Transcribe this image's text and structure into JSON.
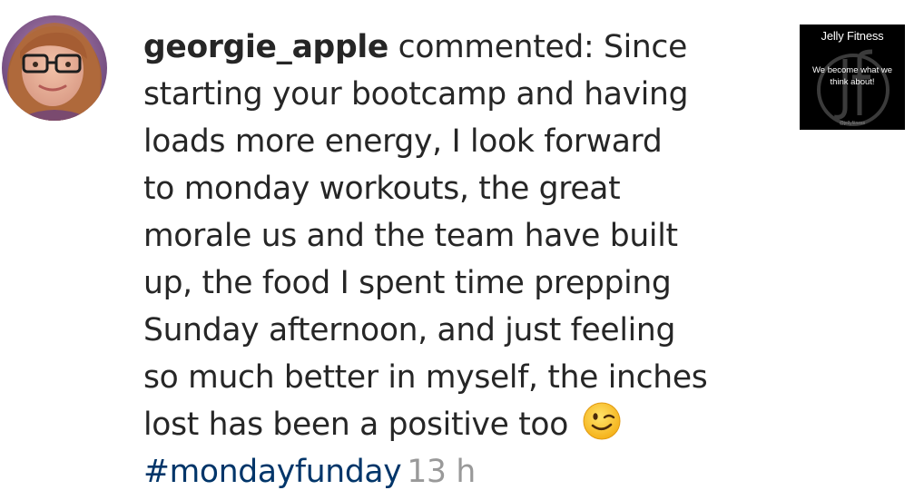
{
  "comment": {
    "username": "georgie_apple",
    "lines": [
      " commented: Since",
      "starting your bootcamp and having",
      "loads more energy, I look forward",
      "to monday workouts, the great",
      "morale us and the team have built",
      "up, the food I spent time prepping",
      "Sunday afternoon, and just feeling",
      "so much better in myself, the inches",
      "lost has been a positive too"
    ],
    "emoji": "winking-face-emoji",
    "hashtag": "#mondayfunday",
    "timestamp": "13 h"
  },
  "post_thumbnail": {
    "brand": "Jelly Fitness",
    "tagline_line1": "We become what we",
    "tagline_line2": "think about!",
    "handle": "@jellyfitness",
    "logo_icon": "jf-monogram-icon"
  },
  "colors": {
    "text": "#262626",
    "hashtag": "#003569",
    "timestamp": "#999999",
    "thumbnail_bg": "#000000"
  }
}
